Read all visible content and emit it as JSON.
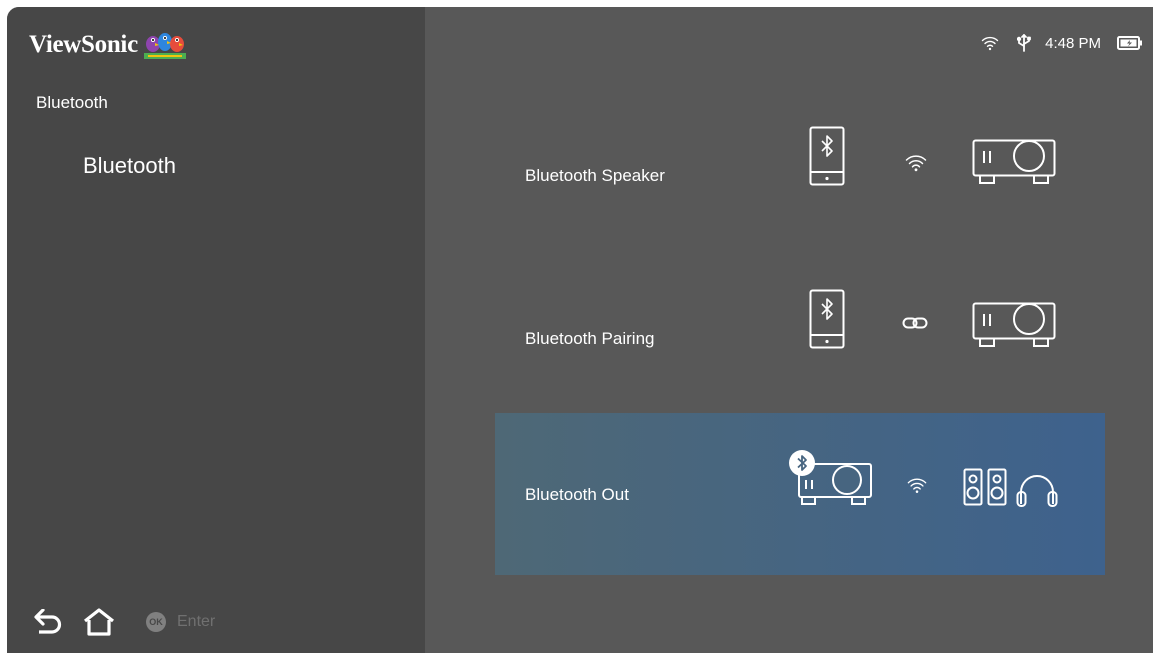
{
  "brand": {
    "name": "ViewSonic"
  },
  "breadcrumb": "Bluetooth",
  "menu": {
    "items": [
      {
        "label": "Bluetooth"
      }
    ]
  },
  "status": {
    "time": "4:48 PM"
  },
  "options": [
    {
      "label": "Bluetooth Speaker"
    },
    {
      "label": "Bluetooth Pairing"
    },
    {
      "label": "Bluetooth Out",
      "selected": true
    }
  ],
  "footer": {
    "ok_badge": "OK",
    "enter_label": "Enter"
  },
  "icons": {
    "back": "back-arrow-icon",
    "home": "home-icon",
    "wifi": "wifi-icon",
    "usb": "usb-icon",
    "battery": "battery-charging-icon",
    "phone": "phone-bluetooth-icon",
    "link": "link-icon",
    "projector": "projector-icon",
    "speaker": "speaker-icon",
    "headphones": "headphones-icon"
  }
}
